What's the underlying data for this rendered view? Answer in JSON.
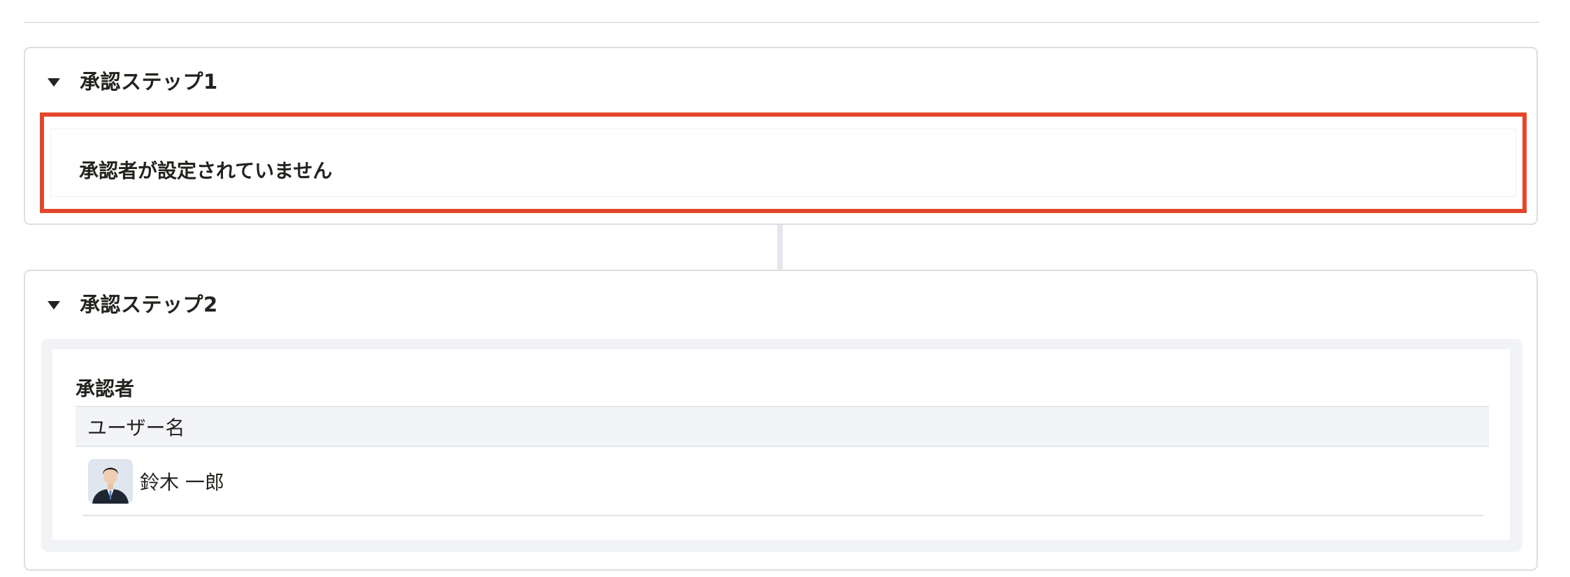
{
  "step1": {
    "title": "承認ステップ1",
    "error_message": "承認者が設定されていません",
    "error_color": "#e3472b"
  },
  "step2": {
    "title": "承認ステップ2",
    "approver_label": "承認者",
    "table": {
      "columns": [
        "ユーザー名"
      ],
      "rows": [
        {
          "avatar_icon": "user-photo-icon",
          "name": "鈴木 一郎"
        }
      ]
    }
  },
  "icons": {
    "collapse": "caret-down-icon"
  }
}
